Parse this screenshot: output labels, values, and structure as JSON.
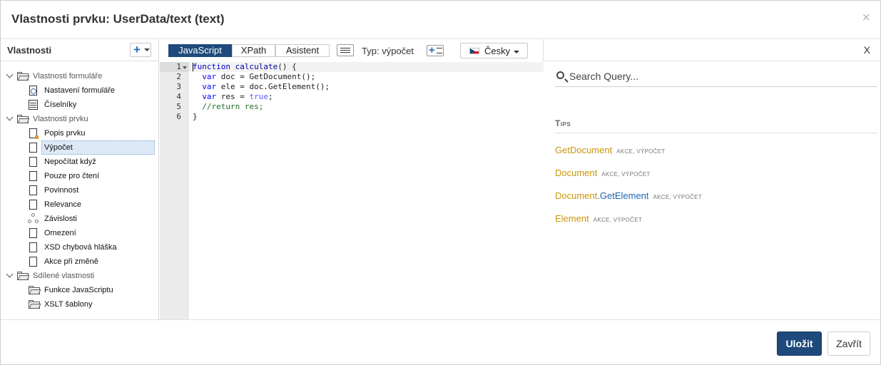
{
  "dialog": {
    "title": "Vlastnosti prvku: UserData/text (text)",
    "close_glyph": "×"
  },
  "left_panel": {
    "title": "Vlastnosti",
    "add_glyph": "+",
    "tree": {
      "group1": "Vlastnosti formuláře",
      "group1_items": [
        "Nastavení formuláře",
        "Číselníky"
      ],
      "group2": "Vlastnosti prvku",
      "group2_items": [
        "Popis prvku",
        "Výpočet",
        "Nepočítat když",
        "Pouze pro čtení",
        "Povinnost",
        "Relevance",
        "Závislosti",
        "Omezení",
        "XSD chybová hláška",
        "Akce při změně"
      ],
      "group3": "Sdílené vlastnosti",
      "group3_items": [
        "Funkce JavaScriptu",
        "XSLT šablony"
      ],
      "selected_item": "Výpočet"
    }
  },
  "editor": {
    "tabs": [
      "JavaScript",
      "XPath",
      "Asistent"
    ],
    "active_tab": "JavaScript",
    "type_label": "Typ:",
    "type_value": "výpočet",
    "insert_glyph": "+",
    "language": "Česky",
    "line_numbers": [
      "1",
      "2",
      "3",
      "4",
      "5",
      "6"
    ],
    "code_tokens": {
      "l1_kw": "function",
      "l1_fn": "calculate",
      "l1_rest": "() {",
      "l2_kw": "var",
      "l2_rest": " doc = GetDocument();",
      "l3_kw": "var",
      "l3_rest": " ele = doc.GetElement();",
      "l4_kw": "var",
      "l4_mid": " res = ",
      "l4_bool": "true",
      "l4_end": ";",
      "l5_cm": "//return res;",
      "l6": "}"
    }
  },
  "right_panel": {
    "close_label": "X",
    "search_placeholder": "Search Query...",
    "tips_title": "Tips",
    "tips": [
      {
        "name": "GetDocument",
        "tag": "AKCE, VÝPOČET"
      },
      {
        "name": "Document",
        "tag": "AKCE, VÝPOČET"
      },
      {
        "name_obj": "Document",
        "sep": ".",
        "name_method": "GetElement",
        "tag": "AKCE, VÝPOČET"
      },
      {
        "name": "Element",
        "tag": "AKCE, VÝPOČET"
      }
    ]
  },
  "footer": {
    "save_label": "Uložit",
    "close_label": "Zavřít"
  },
  "colors": {
    "primary": "#1e4a7c",
    "tip_name": "#c8960c",
    "tip_method": "#1f66b0",
    "selected_row": "#dde9f6"
  }
}
